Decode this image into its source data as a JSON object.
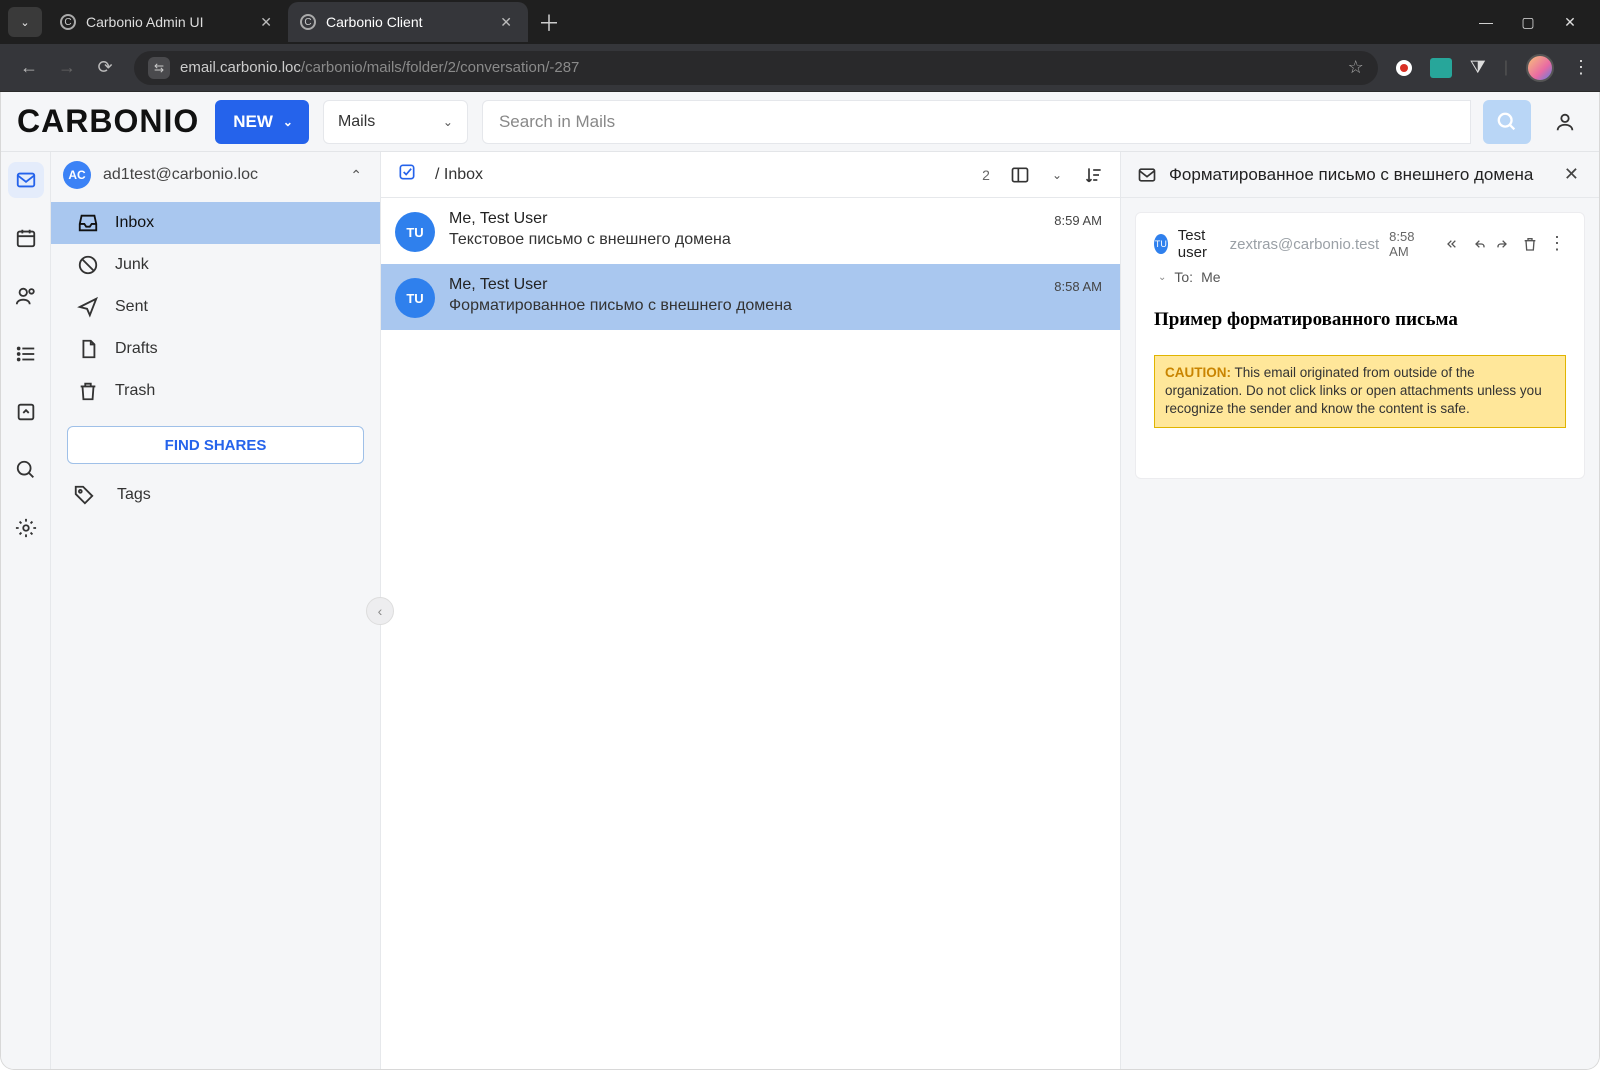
{
  "browser": {
    "tabs": [
      {
        "title": "Carbonio Admin UI",
        "active": false
      },
      {
        "title": "Carbonio Client",
        "active": true
      }
    ],
    "url_host": "email.carbonio.loc",
    "url_path": "/carbonio/mails/folder/2/conversation/-287"
  },
  "app_header": {
    "logo": "CARBONIO",
    "new_label": "NEW",
    "scope": "Mails",
    "search_placeholder": "Search in Mails"
  },
  "account": {
    "initials": "AC",
    "email": "ad1test@carbonio.loc"
  },
  "folders": {
    "inbox": "Inbox",
    "junk": "Junk",
    "sent": "Sent",
    "drafts": "Drafts",
    "trash": "Trash",
    "find_shares": "FIND SHARES",
    "tags": "Tags"
  },
  "message_list": {
    "breadcrumb": "/ Inbox",
    "count": "2",
    "items": [
      {
        "initials": "TU",
        "from": "Me, Test User",
        "subject": "Текстовое письмо с внешнего домена",
        "time": "8:59 AM",
        "selected": false
      },
      {
        "initials": "TU",
        "from": "Me, Test User",
        "subject": "Форматированное письмо с внешнего домена",
        "time": "8:58 AM",
        "selected": true
      }
    ]
  },
  "reader": {
    "title": "Форматированное письмо с внешнего домена",
    "avatar": "TU",
    "sender_name": "Test user",
    "sender_email": "zextras@carbonio.test",
    "time": "8:58 AM",
    "to_label": "To:",
    "to_value": "Me",
    "body_title": "Пример форматированного письма",
    "caution_label": "CAUTION:",
    "caution_text": " This email originated from outside of the organization. Do not click links or open attachments unless you recognize the sender and know the content is safe."
  }
}
